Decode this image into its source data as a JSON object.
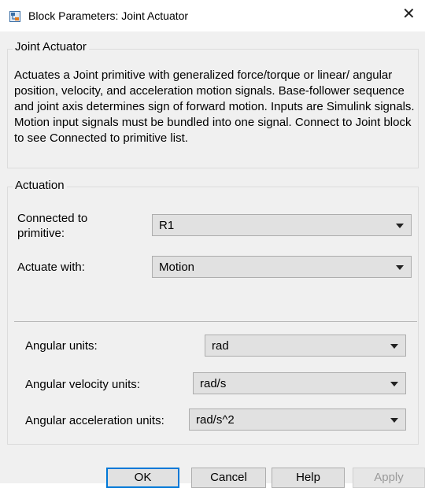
{
  "window": {
    "title": "Block Parameters: Joint Actuator",
    "close_icon": "close-icon"
  },
  "block": {
    "group_title": "Joint Actuator",
    "description": "Actuates a Joint primitive with generalized force/torque or linear/ angular position, velocity, and acceleration motion signals. Base-follower sequence and joint axis determines sign of forward motion. Inputs are Simulink signals. Motion input signals must be bundled into one signal. Connect to Joint block to see Connected to primitive list."
  },
  "actuation": {
    "group_title": "Actuation",
    "connected_label": "Connected to primitive:",
    "connected_value": "R1",
    "actuate_label": "Actuate with:",
    "actuate_value": "Motion"
  },
  "units": {
    "angular_label": "Angular units:",
    "angular_value": "rad",
    "velocity_label": "Angular velocity units:",
    "velocity_value": "rad/s",
    "accel_label": "Angular acceleration units:",
    "accel_value": "rad/s^2"
  },
  "buttons": {
    "ok": "OK",
    "cancel": "Cancel",
    "help": "Help",
    "apply": "Apply"
  },
  "colors": {
    "default_button_border": "#0078d7",
    "dialog_background": "#f0f0f0"
  }
}
